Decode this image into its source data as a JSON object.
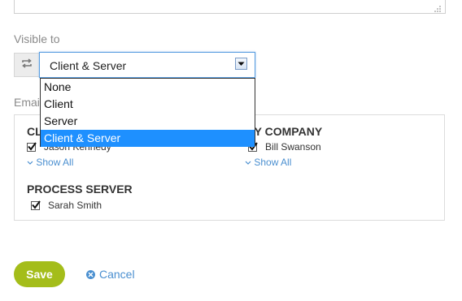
{
  "visibility": {
    "label": "Visible to",
    "selected": "Client & Server",
    "options": [
      "None",
      "Client",
      "Server",
      "Client & Server"
    ]
  },
  "email": {
    "label": "Email",
    "groups": [
      {
        "title": "CLIENT",
        "members": [
          {
            "name": "Jason Kennedy",
            "checked": true
          }
        ],
        "show_all": "Show All"
      },
      {
        "title": "MY COMPANY",
        "members": [
          {
            "name": "Bill Swanson",
            "checked": true
          }
        ],
        "show_all": "Show All"
      },
      {
        "title": "PROCESS SERVER",
        "members": [
          {
            "name": "Sarah Smith",
            "checked": true
          }
        ]
      }
    ]
  },
  "actions": {
    "save_label": "Save",
    "cancel_label": "Cancel"
  },
  "colors": {
    "save_bg": "#a4bd1a",
    "link": "#4a8fd0",
    "dropdown_highlight": "#1e90ff",
    "focus_border": "#5a9ee0"
  }
}
